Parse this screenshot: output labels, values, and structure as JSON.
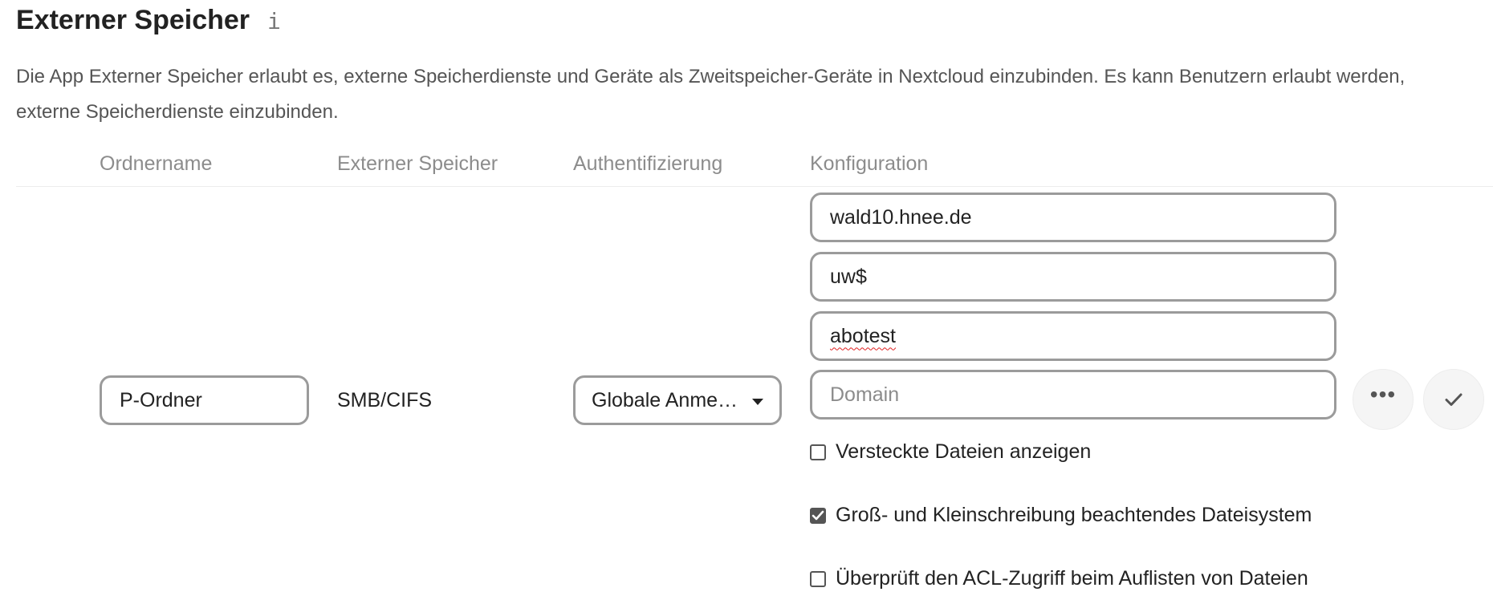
{
  "header": {
    "title": "Externer Speicher",
    "info_icon": "info-icon",
    "info_glyph": "i",
    "description_line1": "Die App Externer Speicher erlaubt es, externe Speicherdienste und Geräte als Zweitspeicher-Geräte in Nextcloud einzubinden. Es kann Benutzern erlaubt werden,",
    "description_line2": "externe Speicherdienste einzubinden."
  },
  "table": {
    "columns": [
      "Ordnername",
      "Externer Speicher",
      "Authentifizierung",
      "Konfiguration"
    ]
  },
  "mount": {
    "folder_name": "P-Ordner",
    "backend": "SMB/CIFS",
    "auth_selected": "Globale Anme…",
    "config": {
      "host": "wald10.hnee.de",
      "share": "uw$",
      "user": "abotest",
      "domain_value": "",
      "domain_placeholder": "Domain"
    },
    "options": [
      {
        "label": "Versteckte Dateien anzeigen",
        "checked": false
      },
      {
        "label": "Groß- und Kleinschreibung beachtendes Dateisystem",
        "checked": true
      },
      {
        "label": "Überprüft den ACL-Zugriff beim Auflisten von Dateien",
        "checked": false
      }
    ],
    "actions": {
      "more_icon": "more-horizontal-icon",
      "more_glyph": "•••",
      "save_icon": "checkmark-icon"
    }
  },
  "colors": {
    "border": "#9b9b9b",
    "muted_text": "#8c8c8c",
    "text": "#222222",
    "button_bg": "#f5f5f5",
    "checkbox_checked": "#555555"
  }
}
